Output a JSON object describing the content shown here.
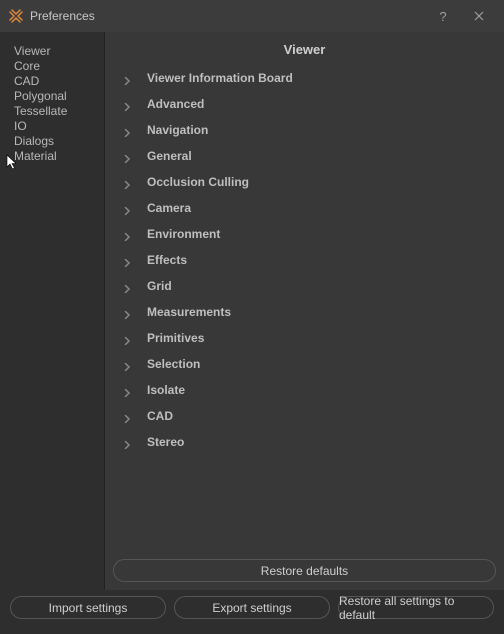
{
  "window": {
    "title": "Preferences"
  },
  "sidebar": {
    "items": [
      {
        "label": "Viewer"
      },
      {
        "label": "Core"
      },
      {
        "label": "CAD"
      },
      {
        "label": "Polygonal"
      },
      {
        "label": "Tessellate"
      },
      {
        "label": "IO"
      },
      {
        "label": "Dialogs"
      },
      {
        "label": "Material"
      }
    ]
  },
  "panel": {
    "title": "Viewer",
    "sections": [
      {
        "label": "Viewer Information Board"
      },
      {
        "label": "Advanced"
      },
      {
        "label": "Navigation"
      },
      {
        "label": "General"
      },
      {
        "label": "Occlusion Culling"
      },
      {
        "label": "Camera"
      },
      {
        "label": "Environment"
      },
      {
        "label": "Effects"
      },
      {
        "label": "Grid"
      },
      {
        "label": "Measurements"
      },
      {
        "label": "Primitives"
      },
      {
        "label": "Selection"
      },
      {
        "label": "Isolate"
      },
      {
        "label": "CAD"
      },
      {
        "label": "Stereo"
      }
    ]
  },
  "buttons": {
    "restore_defaults": "Restore defaults",
    "import_settings": "Import settings",
    "export_settings": "Export settings",
    "restore_all": "Restore all settings to default"
  }
}
